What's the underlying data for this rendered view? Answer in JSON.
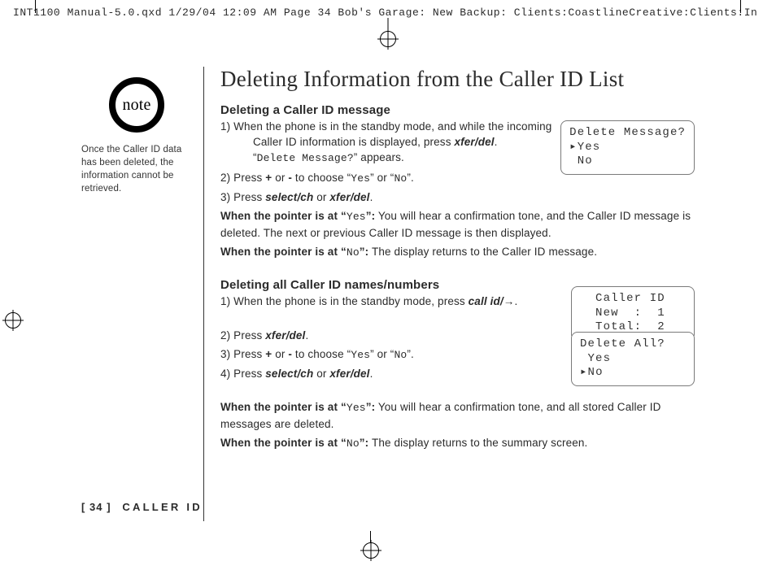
{
  "slug": "INT1100 Manual-5.0.qxd  1/29/04  12:09 AM  Page 34 Bob's Garage: New Backup: Clients:CoastlineCreative:Clients:In",
  "sidebar": {
    "note_label": "note",
    "note_text": "Once the Caller ID data has been deleted, the information cannot be retrieved."
  },
  "title": "Deleting Information from the Caller ID List",
  "section_a": {
    "heading": "Deleting a Caller ID message",
    "s1_a": "1)  When the phone is in the standby mode, and while the incoming",
    "s1_b": "Caller ID information is displayed, press ",
    "s1_btn": "xfer/del",
    "s1_c": ".",
    "s1_d": "“",
    "s1_mono": "Delete Message?",
    "s1_e": "” appears.",
    "s2_a": "2)  Press ",
    "s2_b": "+",
    "s2_c": " or ",
    "s2_d": "-",
    "s2_e": " to choose “",
    "s2_yes": "Yes",
    "s2_f": "” or “",
    "s2_no": "No",
    "s2_g": "”.",
    "s3_a": "3)  Press ",
    "s3_b": "select/ch",
    "s3_c": " or ",
    "s3_d": "xfer/del",
    "s3_e": ".",
    "p_yes_a": "When the pointer is at “",
    "p_yes_m": "Yes",
    "p_yes_b": "”:",
    "p_yes_c": " You will hear a confirmation tone, and the Caller ID message is deleted. The next or previous Caller ID message is then displayed.",
    "p_no_a": "When the pointer is at “",
    "p_no_m": "No",
    "p_no_b": "”:",
    "p_no_c": " The display returns to the Caller ID message."
  },
  "section_b": {
    "heading": "Deleting all Caller ID names/numbers",
    "s1_a": "1)  When the phone is in the standby mode, press ",
    "s1_btn": "call id/",
    "s1_arrow": "→",
    "s1_b": ".",
    "s2_a": "2)  Press ",
    "s2_b": "xfer/del",
    "s2_c": ".",
    "s3_a": "3)  Press ",
    "s3_b": "+",
    "s3_c": " or ",
    "s3_d": "-",
    "s3_e": " to choose “",
    "s3_yes": "Yes",
    "s3_f": "” or “",
    "s3_no": "No",
    "s3_g": "”.",
    "s4_a": "4)  Press ",
    "s4_b": "select/ch",
    "s4_c": " or ",
    "s4_d": "xfer/del",
    "s4_e": ".",
    "p_yes_a": "When the pointer is at “",
    "p_yes_m": "Yes",
    "p_yes_b": "”:",
    "p_yes_c": " You will hear a confirmation tone, and all stored Caller ID messages are deleted.",
    "p_no_a": "When the pointer is at “",
    "p_no_m": "No",
    "p_no_b": "”:",
    "p_no_c": " The display returns to the summary screen."
  },
  "lcd": {
    "a": "Delete Message?\n▸Yes\n No",
    "b": "  Caller ID\n  New  :  1\n  Total:  2",
    "c": "Delete All?\n Yes\n▸No"
  },
  "footer": {
    "page": "[ 34 ]",
    "section": "CALLER ID"
  }
}
